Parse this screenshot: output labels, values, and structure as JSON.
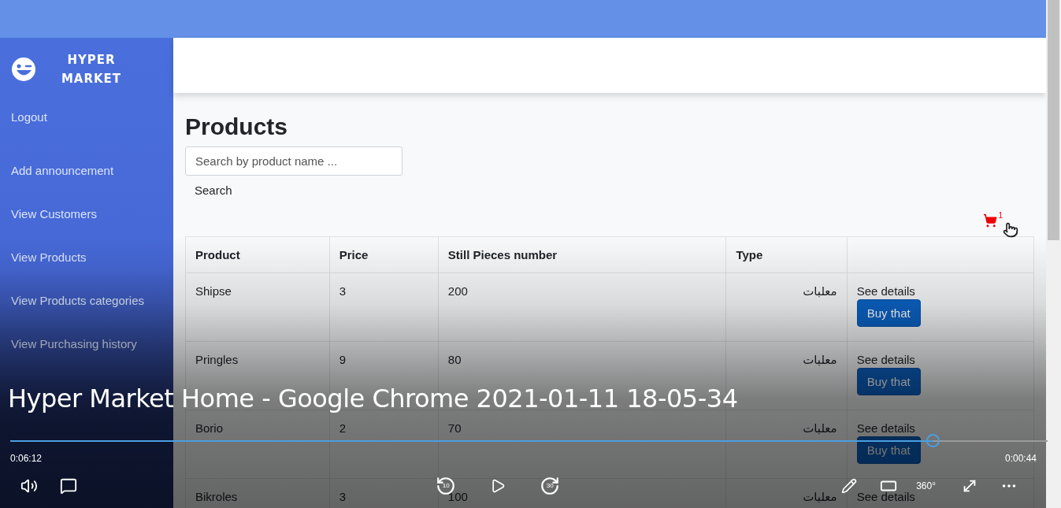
{
  "brand": {
    "title": "HYPER MARKET"
  },
  "sidebar": {
    "items": [
      {
        "label": "Logout"
      },
      {
        "label": "Add announcement"
      },
      {
        "label": "View Customers"
      },
      {
        "label": "View Products"
      },
      {
        "label": "View Products categories"
      },
      {
        "label": "View Purchasing history"
      }
    ]
  },
  "page": {
    "title": "Products",
    "search": {
      "placeholder": "Search by product name ..."
    },
    "search_button": "Search",
    "cart_count": "1"
  },
  "table": {
    "columns": [
      "Product",
      "Price",
      "Still Pieces number",
      "Type"
    ],
    "rows": [
      {
        "cells": [
          "Shipse",
          "3",
          "200",
          "معلبات"
        ],
        "link": "See details",
        "button": "Buy that"
      },
      {
        "cells": [
          "Pringles",
          "9",
          "80",
          "معلبات"
        ],
        "link": "See details",
        "button": "Buy that"
      },
      {
        "cells": [
          "Borio",
          "2",
          "70",
          "معلبات"
        ],
        "link": "See details",
        "button": "Buy that"
      },
      {
        "cells": [
          "Bikroles",
          "3",
          "100",
          "معلبات"
        ],
        "link": "See details"
      }
    ]
  },
  "player": {
    "title": "Hyper Market Home - Google Chrome 2021-01-11 18-05-34",
    "level": 0.89,
    "elapsed": "0:06:12",
    "remaining": "0:00:44",
    "skip_back": "10",
    "skip_forward": "30",
    "vr_label": "360°"
  }
}
